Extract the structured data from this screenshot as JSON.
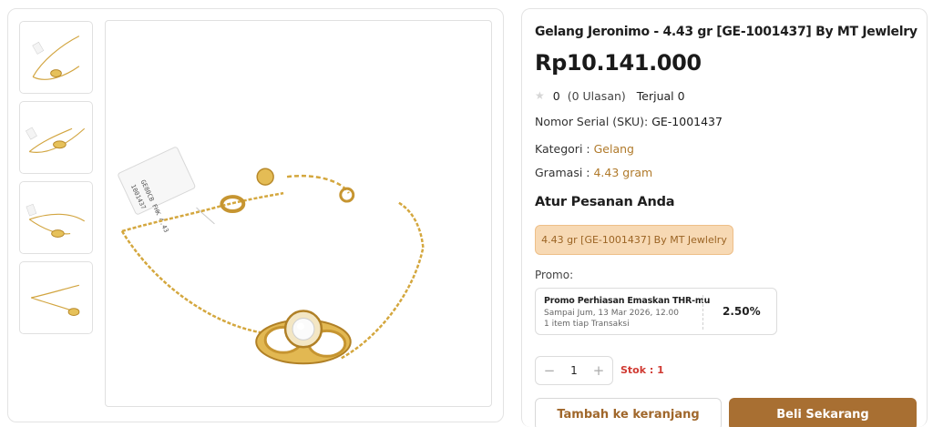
{
  "product": {
    "title": "Gelang Jeronimo - 4.43 gr [GE-1001437] By MT Jewlelry",
    "price": "Rp10.141.000",
    "rating_value": "0",
    "reviews": "(0 Ulasan)",
    "sold": "Terjual 0",
    "sku_label": "Nomor Serial (SKU):",
    "sku_value": "GE-1001437",
    "category_label": "Kategori :",
    "category_value": "Gelang",
    "weight_label": "Gramasi :",
    "weight_value": "4.43 gram"
  },
  "gallery": {
    "thumbnails": [
      {
        "alt": "bracelet-thumb-1"
      },
      {
        "alt": "bracelet-thumb-2"
      },
      {
        "alt": "bracelet-thumb-3"
      },
      {
        "alt": "bracelet-thumb-4"
      }
    ],
    "tag_text_1": "1001437",
    "tag_text_2": "GE80CB FHK 4.43"
  },
  "order": {
    "section_title": "Atur Pesanan Anda",
    "variant_label": "4.43 gr [GE-1001437] By MT Jewlelry",
    "promo_label": "Promo:",
    "promo_name": "Promo Perhiasan Emaskan THR-mu",
    "promo_date": "Sampai Jum, 13 Mar 2026, 12.00",
    "promo_rule": "1 item tiap Transaksi",
    "promo_percent": "2.50%",
    "quantity": "1",
    "minus_symbol": "−",
    "plus_symbol": "+",
    "stock_label": "Stok : 1",
    "add_to_cart": "Tambah ke keranjang",
    "buy_now": "Beli Sekarang"
  },
  "colors": {
    "accent": "#a86f32",
    "gold_text": "#b07a2b",
    "chip_bg": "#f7d9b4",
    "stock_red": "#d03a32"
  },
  "icons": {
    "rating": "star-icon"
  }
}
